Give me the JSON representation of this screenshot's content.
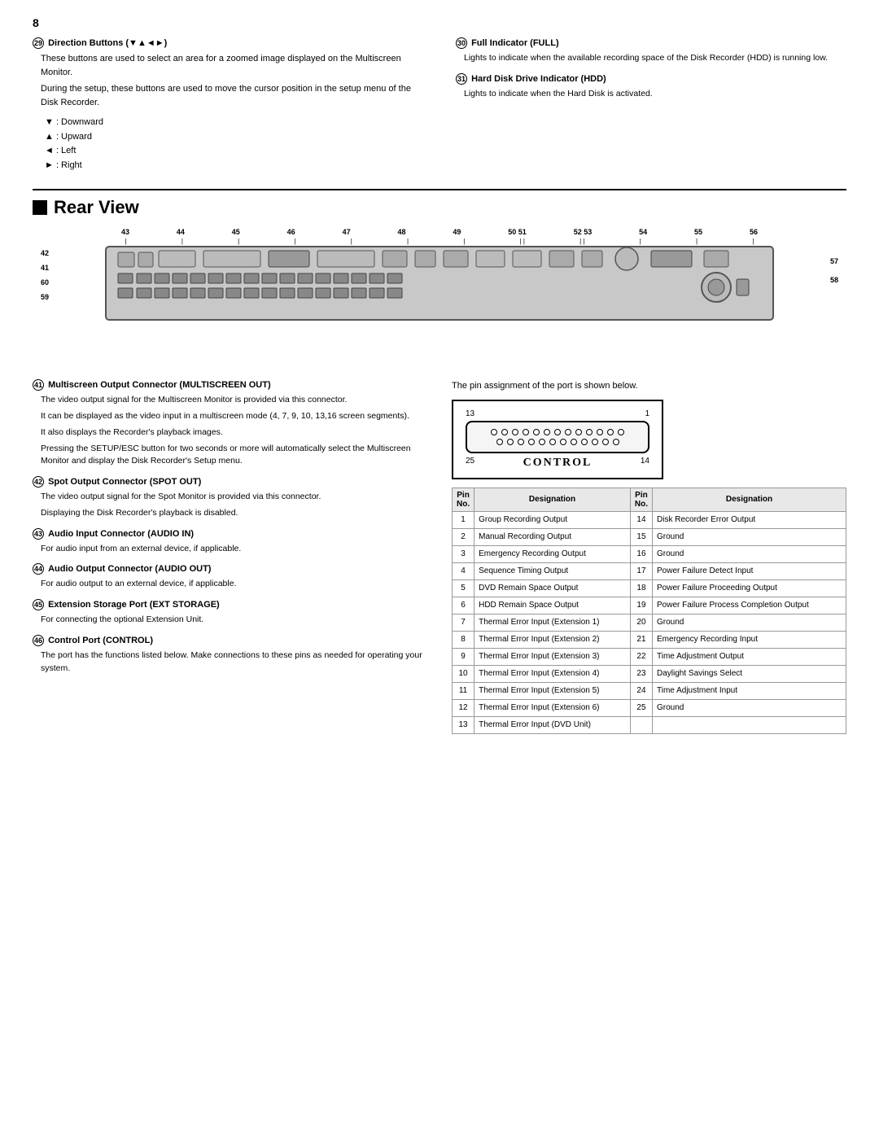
{
  "page": {
    "number": "8"
  },
  "top_left": {
    "section_num": "29",
    "title": "Direction Buttons (▼▲◄►)",
    "body1": "These buttons are used to select an area for a zoomed image displayed on the Multiscreen Monitor.",
    "body2": "During the setup, these buttons are used to move the cursor position in the setup menu of the Disk Recorder.",
    "list": [
      "▼ :  Downward",
      "▲ :  Upward",
      "◄ :  Left",
      "► :  Right"
    ]
  },
  "top_right": {
    "section_30": {
      "num": "30",
      "title": "Full Indicator (FULL)",
      "body": "Lights to indicate when the available recording space of the Disk Recorder (HDD) is running low."
    },
    "section_31": {
      "num": "31",
      "title": "Hard Disk Drive Indicator (HDD)",
      "body": "Lights to indicate when the Hard Disk is activated."
    }
  },
  "rear_view": {
    "title": "Rear View",
    "top_numbers": [
      "43",
      "44",
      "45",
      "46",
      "47",
      "48",
      "49",
      "50 51",
      "52 53",
      "54",
      "55",
      "56"
    ],
    "side_left_numbers": [
      "42",
      "41",
      "60",
      "59"
    ],
    "side_right_numbers": [
      "57",
      "58"
    ]
  },
  "descriptions": {
    "items": [
      {
        "num": "41",
        "title": "Multiscreen Output Connector (MULTISCREEN OUT)",
        "body": "The video output signal for the Multiscreen Monitor is provided via this connector.\nIt can be displayed as the video input in a multiscreen mode (4, 7, 9, 10, 13,16 screen segments).\nIt also displays the Recorder's playback images.\nPressing the SETUP/ESC button for two seconds or more will automatically select the Multiscreen Monitor and display the Disk Recorder's Setup menu."
      },
      {
        "num": "42",
        "title": "Spot Output Connector (SPOT OUT)",
        "body": "The video output signal for the Spot Monitor is provided via this connector.\nDisplaying the Disk Recorder's playback is disabled."
      },
      {
        "num": "43",
        "title": "Audio Input Connector (AUDIO IN)",
        "body": "For audio input from an external device, if applicable."
      },
      {
        "num": "44",
        "title": "Audio Output Connector (AUDIO OUT)",
        "body": "For audio output to an external device, if applicable."
      },
      {
        "num": "45",
        "title": "Extension Storage Port (EXT STORAGE)",
        "body": "For connecting the optional Extension Unit."
      },
      {
        "num": "46",
        "title": "Control Port (CONTROL)",
        "body": "The port has the functions listed below. Make connections to these pins as needed for operating your system."
      }
    ]
  },
  "control_diagram": {
    "pin_top_left": "13",
    "pin_top_right": "1",
    "pin_bottom_left": "25",
    "pin_bottom_right": "14",
    "label": "CONTROL",
    "note": "The pin assignment of the port is shown below."
  },
  "pin_table": {
    "headers": [
      "Pin No.",
      "Designation",
      "Pin No.",
      "Designation"
    ],
    "rows": [
      {
        "pin_l": "1",
        "des_l": "Group Recording Output",
        "pin_r": "14",
        "des_r": "Disk Recorder Error Output"
      },
      {
        "pin_l": "2",
        "des_l": "Manual Recording Output",
        "pin_r": "15",
        "des_r": "Ground"
      },
      {
        "pin_l": "3",
        "des_l": "Emergency Recording Output",
        "pin_r": "16",
        "des_r": "Ground"
      },
      {
        "pin_l": "4",
        "des_l": "Sequence Timing Output",
        "pin_r": "17",
        "des_r": "Power Failure Detect Input"
      },
      {
        "pin_l": "5",
        "des_l": "DVD Remain Space Output",
        "pin_r": "18",
        "des_r": "Power Failure Proceeding Output"
      },
      {
        "pin_l": "6",
        "des_l": "HDD Remain Space Output",
        "pin_r": "19",
        "des_r": "Power Failure Process Completion Output"
      },
      {
        "pin_l": "7",
        "des_l": "Thermal Error Input (Extension 1)",
        "pin_r": "20",
        "des_r": "Ground"
      },
      {
        "pin_l": "8",
        "des_l": "Thermal Error Input (Extension 2)",
        "pin_r": "21",
        "des_r": "Emergency Recording Input"
      },
      {
        "pin_l": "9",
        "des_l": "Thermal Error Input (Extension 3)",
        "pin_r": "22",
        "des_r": "Time Adjustment Output"
      },
      {
        "pin_l": "10",
        "des_l": "Thermal Error Input (Extension 4)",
        "pin_r": "23",
        "des_r": "Daylight Savings Select"
      },
      {
        "pin_l": "11",
        "des_l": "Thermal Error Input (Extension 5)",
        "pin_r": "24",
        "des_r": "Time Adjustment Input"
      },
      {
        "pin_l": "12",
        "des_l": "Thermal Error Input (Extension 6)",
        "pin_r": "25",
        "des_r": "Ground"
      },
      {
        "pin_l": "13",
        "des_l": "Thermal Error Input (DVD Unit)",
        "pin_r": "",
        "des_r": ""
      }
    ]
  }
}
